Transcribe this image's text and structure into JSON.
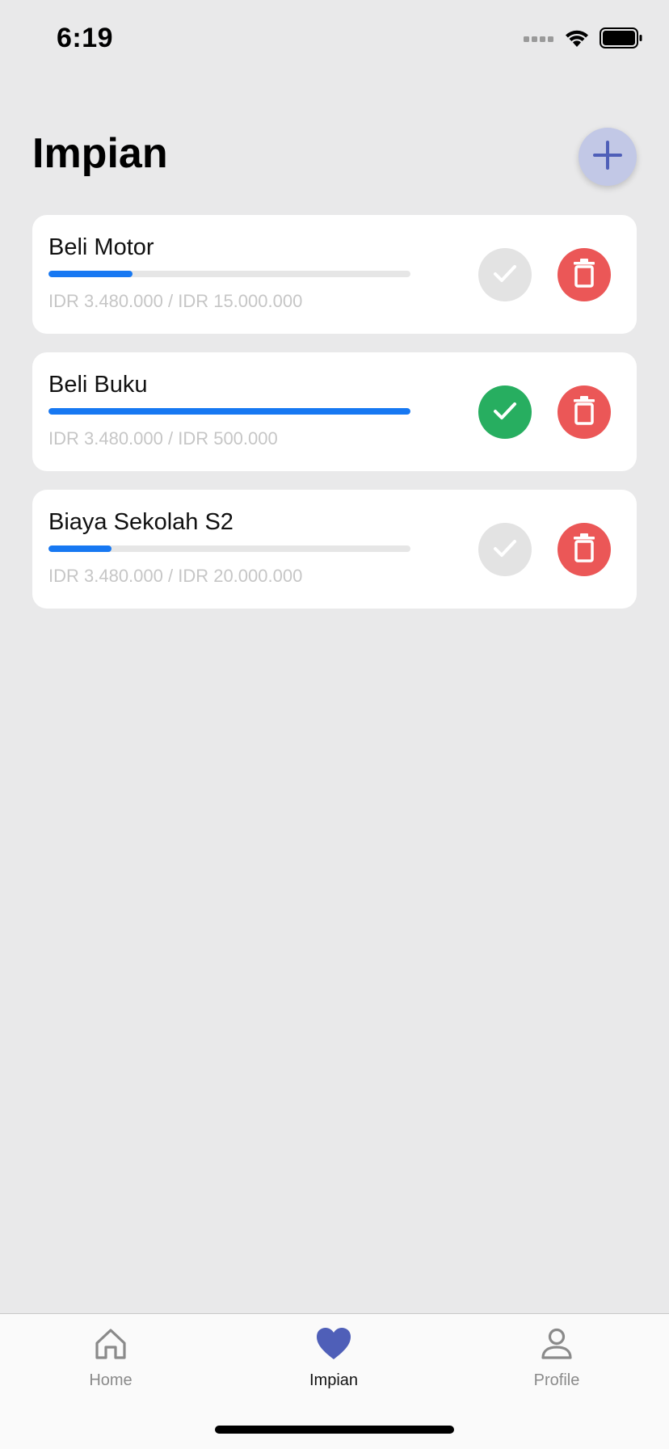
{
  "status_bar": {
    "time": "6:19"
  },
  "header": {
    "title": "Impian",
    "add_icon": "plus-icon"
  },
  "dreams": [
    {
      "name": "Beli Motor",
      "amount_text": "IDR 3.480.000 / IDR 15.000.000",
      "progress": 0.232,
      "completed": false
    },
    {
      "name": "Beli Buku",
      "amount_text": "IDR 3.480.000 / IDR 500.000",
      "progress": 1.0,
      "completed": true
    },
    {
      "name": "Biaya Sekolah S2",
      "amount_text": "IDR 3.480.000 / IDR 20.000.000",
      "progress": 0.174,
      "completed": false
    }
  ],
  "tab_bar": {
    "tabs": [
      {
        "label": "Home",
        "icon": "home-icon",
        "active": false
      },
      {
        "label": "Impian",
        "icon": "heart-icon",
        "active": true
      },
      {
        "label": "Profile",
        "icon": "person-icon",
        "active": false
      }
    ]
  },
  "colors": {
    "background": "#e9e9ea",
    "accent": "#4f5fb8",
    "progress": "#1778f2",
    "success": "#27ae60",
    "danger": "#eb5757"
  }
}
